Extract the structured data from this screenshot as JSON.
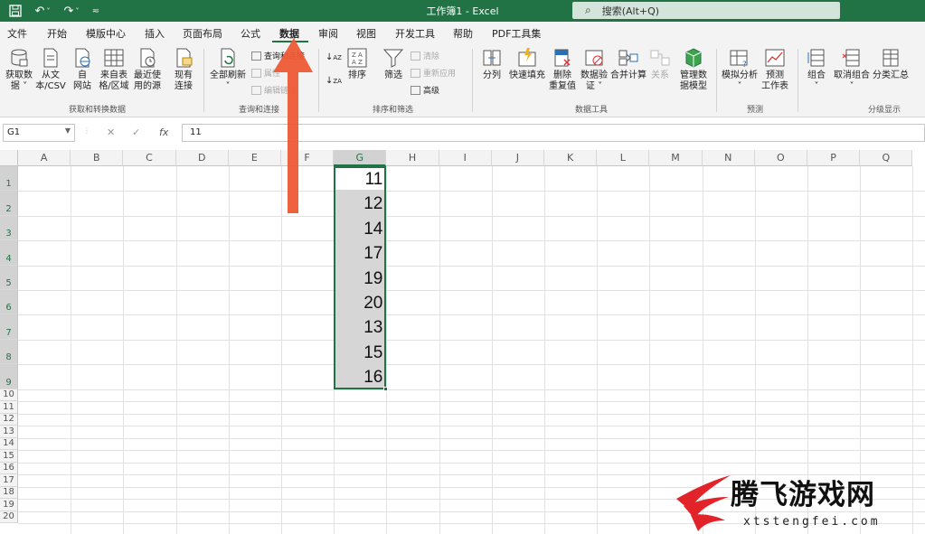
{
  "window": {
    "title": "工作簿1  -  Excel",
    "search_placeholder": "搜索(Alt+Q)"
  },
  "menu_tabs": [
    "文件",
    "开始",
    "模版中心",
    "插入",
    "页面布局",
    "公式",
    "数据",
    "审阅",
    "视图",
    "开发工具",
    "帮助",
    "PDF工具集"
  ],
  "active_tab": "数据",
  "ribbon": {
    "get_data_group": {
      "label": "获取和转换数据",
      "buttons": [
        "获取数\n据 ˅",
        "从文\n本/CSV",
        "自\n网站",
        "来自表\n格/区域",
        "最近使\n用的源",
        "现有\n连接"
      ]
    },
    "queries_group": {
      "label": "查询和连接",
      "refresh_all": "全部刷新\n˅",
      "small": [
        "查询和连接",
        "属性",
        "编辑链接"
      ]
    },
    "sort_group": {
      "label": "排序和筛选",
      "sort": "排序",
      "filter": "筛选",
      "small": [
        "清除",
        "重新应用",
        "高级"
      ]
    },
    "data_tools_group": {
      "label": "数据工具",
      "buttons": [
        "分列",
        "快速填充",
        "删除\n重复值",
        "数据验\n证 ˅",
        "合并计算",
        "关系",
        "管理数\n据模型"
      ]
    },
    "forecast_group": {
      "label": "预测",
      "buttons": [
        "模拟分析\n˅",
        "预测\n工作表"
      ]
    },
    "outline_group": {
      "label": "分级显示",
      "buttons": [
        "组合\n˅",
        "取消组合\n˅",
        "分类汇总"
      ]
    }
  },
  "formula_bar": {
    "name_box": "G1",
    "fx_label": "fx",
    "formula": "11"
  },
  "sheet": {
    "columns": [
      "A",
      "B",
      "C",
      "D",
      "E",
      "F",
      "G",
      "H",
      "I",
      "J",
      "K",
      "L",
      "M",
      "N",
      "O",
      "P",
      "Q"
    ],
    "rows": [
      "1",
      "2",
      "3",
      "4",
      "5",
      "6",
      "7",
      "8",
      "9",
      "10",
      "11",
      "12",
      "13",
      "14",
      "15",
      "16",
      "17",
      "18",
      "19",
      "20"
    ],
    "column_g_values": [
      "11",
      "12",
      "14",
      "17",
      "19",
      "20",
      "13",
      "15",
      "16"
    ]
  },
  "watermark": {
    "title": "腾飞游戏网",
    "url": "xtstengfei.com"
  },
  "colors": {
    "excel_green": "#217346",
    "arrow": "#ee5a35"
  }
}
